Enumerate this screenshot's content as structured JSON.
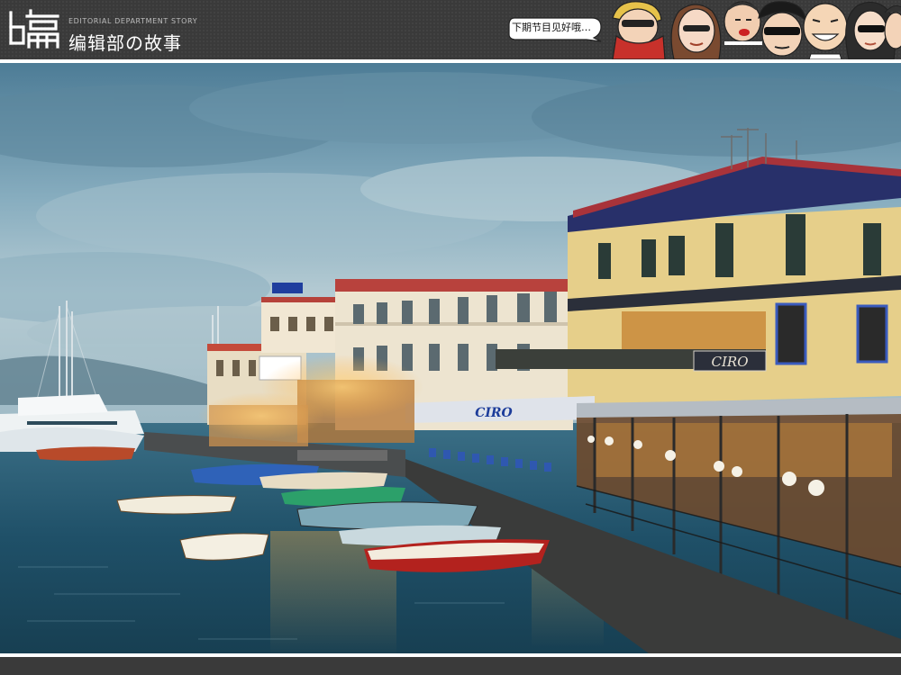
{
  "header": {
    "logo_glyph": "编",
    "sub_caption": "EDITORIAL DEPARTMENT STORY",
    "title": "编辑部の故事",
    "speech_text": "下期节目见好哦…",
    "colors": {
      "band": "#3a3a3a",
      "title": "#ffffff"
    }
  },
  "photo": {
    "description_icon": "harbor-photo",
    "sign_cafe": "CIRO",
    "sign_awning": "CIRO"
  }
}
